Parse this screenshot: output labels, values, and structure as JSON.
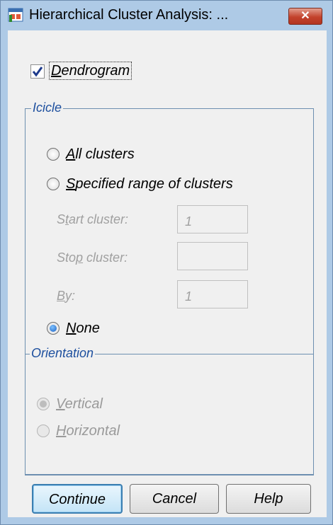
{
  "window": {
    "title": "Hierarchical Cluster Analysis: ...",
    "close_glyph": "✕"
  },
  "dendrogram": {
    "label": "Dendrogram",
    "mnemonic": "D",
    "rest": "endrogram",
    "checked": true
  },
  "icicle": {
    "title": "Icicle",
    "options": [
      {
        "id": "all",
        "mnemonic": "A",
        "rest": "ll clusters",
        "selected": false
      },
      {
        "id": "range",
        "mnemonic": "S",
        "rest": "pecified range of clusters",
        "selected": false
      },
      {
        "id": "none",
        "mnemonic": "N",
        "rest": "one",
        "selected": true
      }
    ],
    "start": {
      "pre": "S",
      "mn": "t",
      "post": "art cluster:",
      "value": "1"
    },
    "stop": {
      "pre": "Sto",
      "mn": "p",
      "post": " cluster:",
      "value": ""
    },
    "by": {
      "pre": "",
      "mn": "B",
      "post": "y:",
      "value": "1"
    }
  },
  "orientation": {
    "title": "Orientation",
    "vertical": {
      "mnemonic": "V",
      "rest": "ertical",
      "selected": true,
      "disabled": true
    },
    "horizontal": {
      "mnemonic": "H",
      "rest": "orizontal",
      "selected": false,
      "disabled": true
    }
  },
  "buttons": {
    "continue": "Continue",
    "cancel": "Cancel",
    "help": "Help"
  },
  "colors": {
    "frame": "#aecae6",
    "group_title": "#1d4f9e",
    "close": "#c3422c"
  }
}
